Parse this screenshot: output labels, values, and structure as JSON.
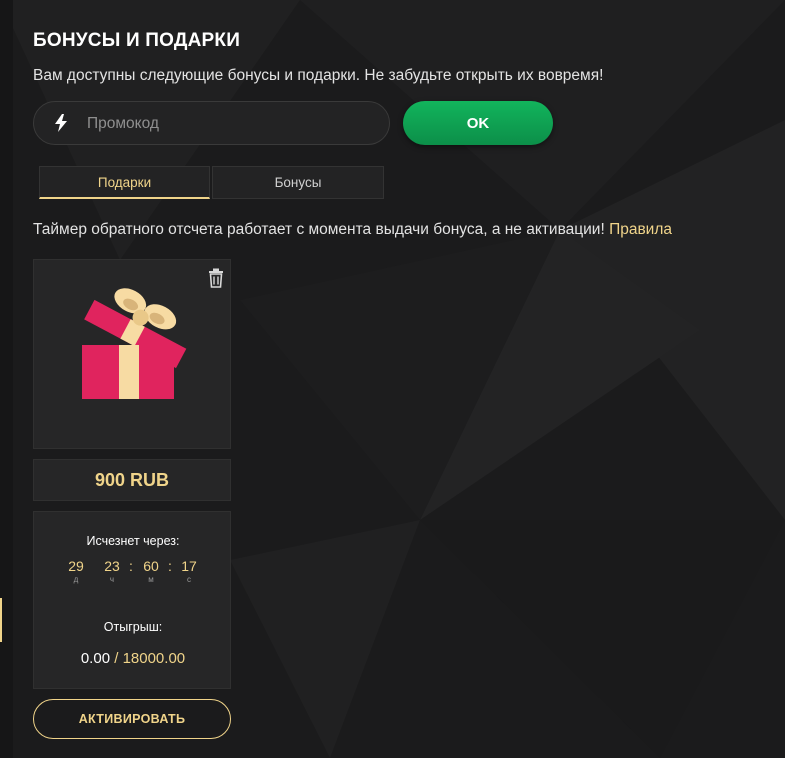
{
  "header": {
    "title": "БОНУСЫ И ПОДАРКИ",
    "subtitle": "Вам доступны следующие бонусы и подарки. Не забудьте открыть их вовремя!"
  },
  "promo": {
    "placeholder": "Промокод",
    "icon": "lightning-icon",
    "submit_label": "OK"
  },
  "tabs": [
    {
      "label": "Подарки",
      "active": true
    },
    {
      "label": "Бонусы",
      "active": false
    }
  ],
  "notice": {
    "text": "Таймер обратного отсчета работает с момента выдачи бонуса, а не активации!",
    "link_label": "Правила"
  },
  "gift_card": {
    "image_icon": "gift-box-icon",
    "delete_icon": "trash-icon",
    "amount": "900 RUB",
    "expires_label": "Исчезнет через:",
    "countdown": [
      {
        "value": "29",
        "unit": "д"
      },
      {
        "value": "23",
        "unit": "ч"
      },
      {
        "value": "60",
        "unit": "м"
      },
      {
        "value": "17",
        "unit": "с"
      }
    ],
    "wager_label": "Отыгрыш:",
    "wager_current": "0.00",
    "wager_separator": "/",
    "wager_target": "18000.00",
    "activate_label": "АКТИВИРОВАТЬ"
  },
  "colors": {
    "accent_gold": "#f0d48a",
    "ok_green": "#12b45c",
    "background": "#1b1b1c",
    "card": "#262627"
  }
}
